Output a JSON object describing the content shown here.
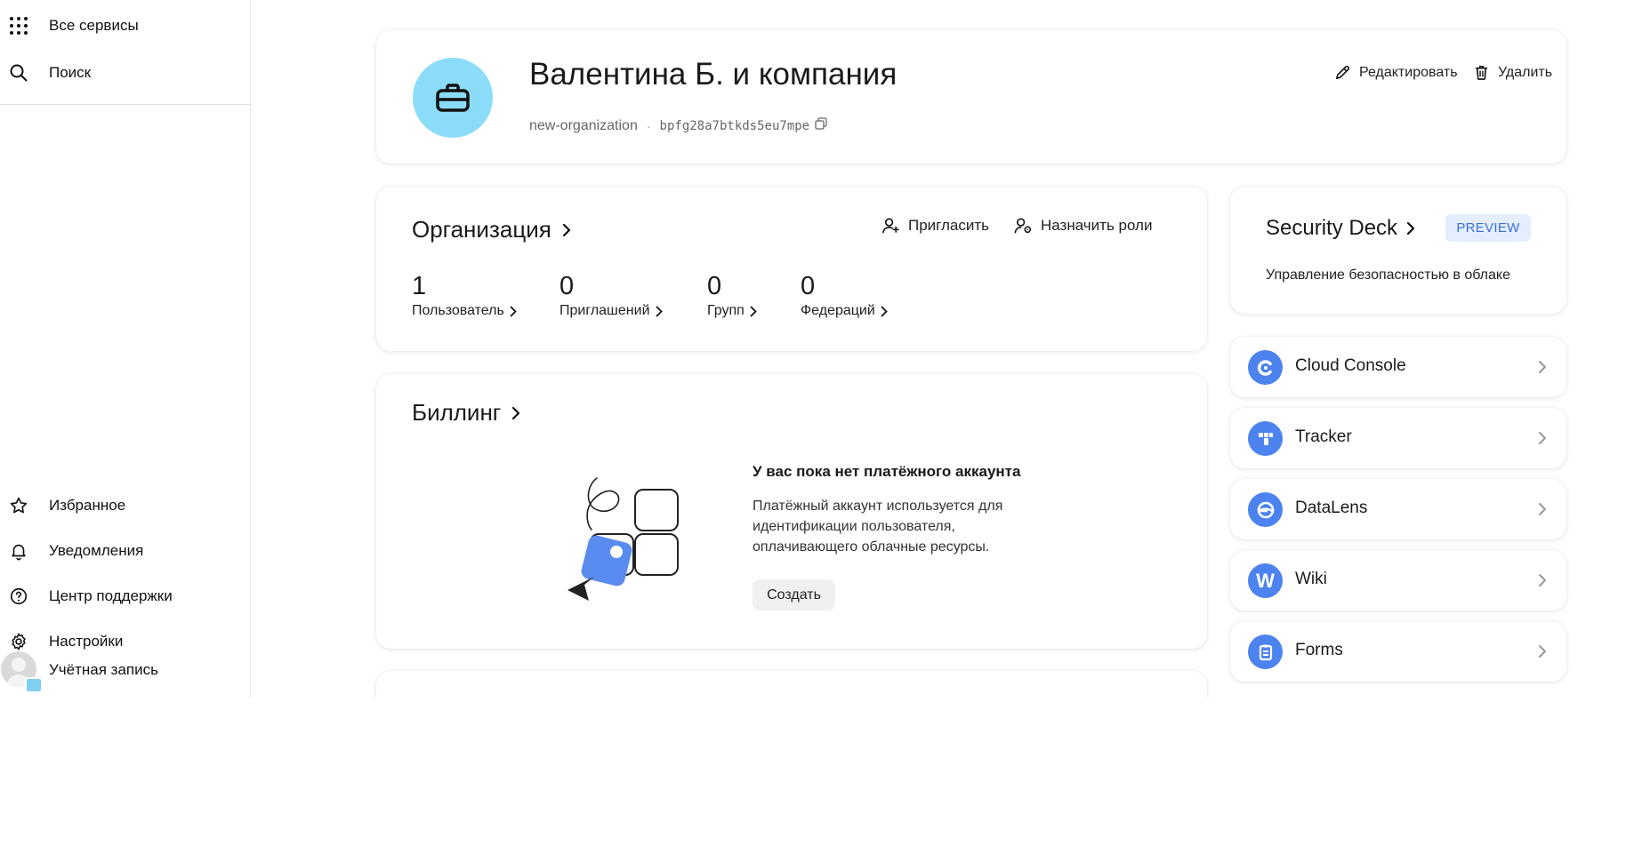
{
  "sidebar": {
    "top_items": [
      {
        "label": "Все сервисы",
        "icon": "grid-icon"
      },
      {
        "label": "Поиск",
        "icon": "search-icon"
      }
    ],
    "bottom_items": [
      {
        "label": "Избранное",
        "icon": "star-icon"
      },
      {
        "label": "Уведомления",
        "icon": "bell-icon"
      },
      {
        "label": "Центр поддержки",
        "icon": "help-icon"
      },
      {
        "label": "Настройки",
        "icon": "gear-icon"
      },
      {
        "label": "Учётная запись",
        "icon": "avatar"
      }
    ]
  },
  "org_header": {
    "title": "Валентина Б. и компания",
    "slug": "new-organization",
    "separator": "·",
    "id": "bpfg28a7btkds5eu7mpe",
    "edit_label": "Редактировать",
    "delete_label": "Удалить"
  },
  "organization": {
    "title": "Организация",
    "invite_label": "Пригласить",
    "roles_label": "Назначить роли",
    "stats": [
      {
        "value": "1",
        "label": "Пользователь"
      },
      {
        "value": "0",
        "label": "Приглашений"
      },
      {
        "value": "0",
        "label": "Групп"
      },
      {
        "value": "0",
        "label": "Федераций"
      }
    ]
  },
  "billing": {
    "title": "Биллинг",
    "empty_title": "У вас пока нет платёжного аккаунта",
    "empty_desc": "Платёжный аккаунт используется для идентификации пользователя, оплачивающего облачные ресурсы.",
    "create_label": "Создать"
  },
  "security_deck": {
    "title": "Security Deck",
    "badge": "PREVIEW",
    "description": "Управление безопасностью в облаке"
  },
  "services": [
    {
      "name": "Cloud Console",
      "icon": "cloud-console-icon"
    },
    {
      "name": "Tracker",
      "icon": "tracker-icon"
    },
    {
      "name": "DataLens",
      "icon": "datalens-icon"
    },
    {
      "name": "Wiki",
      "icon": "wiki-icon",
      "glyph": "W"
    },
    {
      "name": "Forms",
      "icon": "forms-icon"
    }
  ],
  "colors": {
    "accent": "#4c83ef",
    "org_logo_bg": "#8bdcf8",
    "preview_bg": "#e4eeff",
    "preview_text": "#3b6fd8"
  }
}
